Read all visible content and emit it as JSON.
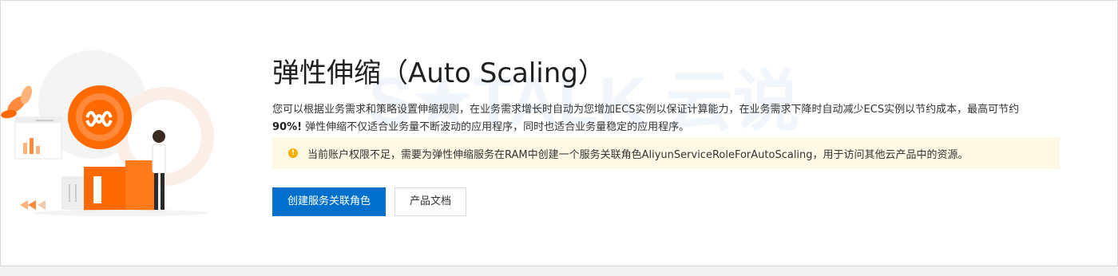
{
  "page": {
    "title": "弹性伸缩（Auto Scaling）",
    "description_line1": "您可以根据业务需求和策略设置伸缩规则，在业务需求增长时自动为您增加ECS实例以保证计算能力，在业务需求下降时自动减少ECS实例以节约成本，最高可节约",
    "description_highlight": "90%!",
    "description_line2": " 弹性伸缩不仅适合业务量不断波动的应用程序，同时也适合业务量稳定的应用程序。"
  },
  "notice": {
    "icon": "warning-icon",
    "icon_glyph": "!",
    "text": "当前账户权限不足，需要为弹性伸缩服务在RAM中创建一个服务关联角色AliyunServiceRoleForAutoScaling，用于访问其他云产品中的资源。"
  },
  "actions": {
    "primary_label": "创建服务关联角色",
    "secondary_label": "产品文档"
  },
  "colors": {
    "primary": "#0070cc",
    "accent_orange": "#ff6a00",
    "notice_bg": "#fff8e5",
    "warning": "#f5b000"
  }
}
